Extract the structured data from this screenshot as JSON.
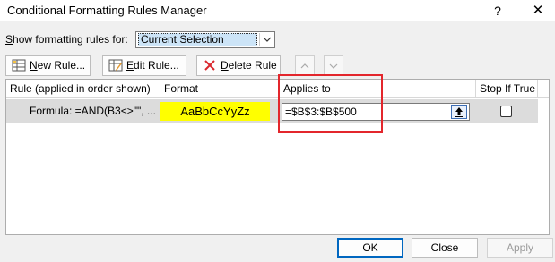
{
  "window": {
    "title": "Conditional Formatting Rules Manager",
    "help_glyph": "?",
    "close_glyph": "✕"
  },
  "show_rules": {
    "label_prefix": "S",
    "label_rest": "how formatting rules for:",
    "selected": "Current Selection"
  },
  "toolbar": {
    "new_rule_u": "N",
    "new_rule_rest": "ew Rule...",
    "edit_rule_u": "E",
    "edit_rule_rest": "dit Rule...",
    "delete_rule_u": "D",
    "delete_rule_rest": "elete Rule",
    "move_up_glyph": "︿",
    "move_down_glyph": "﹀"
  },
  "table": {
    "columns": [
      "Rule (applied in order shown)",
      "Format",
      "Applies to",
      "Stop If True"
    ],
    "rows": [
      {
        "rule": "Formula: =AND(B3<>\"\", ...",
        "format_preview": "AaBbCcYyZz",
        "applies_to": "=$B$3:$B$500",
        "stop_if_true": false
      }
    ]
  },
  "footer": {
    "ok": "OK",
    "close": "Close",
    "apply": "Apply"
  },
  "colors": {
    "format_preview_bg": "#ffff00",
    "highlight_box": "#e3262c",
    "selected_row": "#dcdcdc"
  }
}
